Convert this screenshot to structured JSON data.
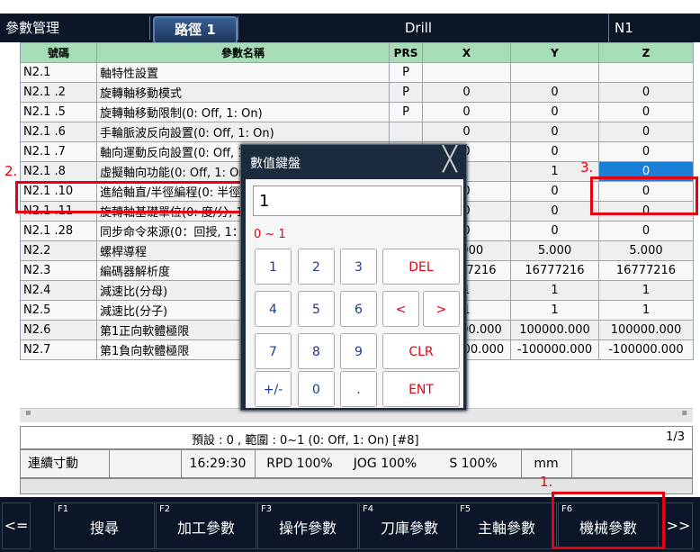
{
  "header": {
    "title": "參數管理",
    "path_tab": "路徑 1",
    "mode": "Drill",
    "program": "N1"
  },
  "columns": [
    "號碼",
    "參數名稱",
    "PRS",
    "X",
    "Y",
    "Z"
  ],
  "rows": [
    {
      "no": "N2.1",
      "name": "軸特性設置",
      "prs": "P",
      "x": "",
      "y": "",
      "z": ""
    },
    {
      "no": "N2.1 .2",
      "name": "旋轉軸移動模式",
      "prs": "P",
      "x": "0",
      "y": "0",
      "z": "0"
    },
    {
      "no": "N2.1 .5",
      "name": "旋轉軸移動限制(0: Off, 1: On)",
      "prs": "P",
      "x": "0",
      "y": "0",
      "z": "0"
    },
    {
      "no": "N2.1 .6",
      "name": "手輪脈波反向設置(0: Off, 1: On)",
      "prs": "",
      "x": "0",
      "y": "0",
      "z": "0"
    },
    {
      "no": "N2.1 .7",
      "name": "軸向運動反向設置(0: Off, 1: On)",
      "prs": "",
      "x": "0",
      "y": "0",
      "z": "0"
    },
    {
      "no": "N2.1 .8",
      "name": "虛擬軸向功能(0: Off, 1: On)",
      "prs": "",
      "x": "",
      "y": "1",
      "z": "0"
    },
    {
      "no": "N2.1 .10",
      "name": "進給軸直/半徑編程(0: 半徑, 1: 直徑)",
      "prs": "",
      "x": "0",
      "y": "0",
      "z": "0"
    },
    {
      "no": "N2.1 .11",
      "name": "旋轉軸基礎單位(0: 度/分, 1: 轉/分)",
      "prs": "",
      "x": "0",
      "y": "0",
      "z": "0"
    },
    {
      "no": "N2.1 .28",
      "name": "同步命令來源(0：回授, 1：命令)",
      "prs": "",
      "x": "0",
      "y": "0",
      "z": "0"
    },
    {
      "no": "N2.2",
      "name": "螺桿導程",
      "prs": "",
      "x": "5.000",
      "y": "5.000",
      "z": "5.000"
    },
    {
      "no": "N2.3",
      "name": "編碼器解析度",
      "prs": "",
      "x": "16777216",
      "y": "16777216",
      "z": "16777216"
    },
    {
      "no": "N2.4",
      "name": "減速比(分母)",
      "prs": "",
      "x": "1",
      "y": "1",
      "z": "1"
    },
    {
      "no": "N2.5",
      "name": "減速比(分子)",
      "prs": "",
      "x": "1",
      "y": "1",
      "z": "1"
    },
    {
      "no": "N2.6",
      "name": "第1正向軟體極限",
      "prs": "",
      "x": "100000.000",
      "y": "100000.000",
      "z": "100000.000"
    },
    {
      "no": "N2.7",
      "name": "第1負向軟體極限",
      "prs": "",
      "x": "-100000.000",
      "y": "-100000.000",
      "z": "-100000.000"
    }
  ],
  "info": {
    "text": "預設 : 0 , 範圍 : 0~1 (0: Off, 1: On) [#8]",
    "page": "1/3"
  },
  "status": {
    "mode": "連續寸動",
    "time": "16:29:30",
    "rpd": "RPD 100%",
    "jog": "JOG 100%",
    "spindle": "S 100%",
    "unit": "mm"
  },
  "fkeys": {
    "prev": "<=",
    "next": ">>",
    "items": [
      {
        "n": "F1",
        "label": "搜尋"
      },
      {
        "n": "F2",
        "label": "加工參數"
      },
      {
        "n": "F3",
        "label": "操作參數"
      },
      {
        "n": "F4",
        "label": "刀庫參數"
      },
      {
        "n": "F5",
        "label": "主軸參數"
      },
      {
        "n": "F6",
        "label": "機械參數"
      }
    ]
  },
  "annotations": {
    "a1": "1.",
    "a2": "2.",
    "a3": "3."
  },
  "dialog": {
    "title": "數值鍵盤",
    "close": "╳",
    "value": "1",
    "range": "0 ~ 1",
    "keys": {
      "k1": "1",
      "k2": "2",
      "k3": "3",
      "del": "DEL",
      "k4": "4",
      "k5": "5",
      "k6": "6",
      "left": "<",
      "right": ">",
      "k7": "7",
      "k8": "8",
      "k9": "9",
      "clr": "CLR",
      "pm": "+/-",
      "k0": "0",
      "dot": ".",
      "ent": "ENT"
    }
  },
  "colors": {
    "header": "#0b1728",
    "table_head": "#a7ddb6",
    "selected": "#1a7fd6",
    "annotation": "#e60012"
  }
}
